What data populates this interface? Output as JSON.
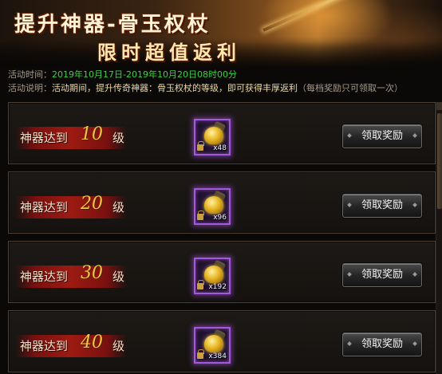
{
  "banner": {
    "title_main": "提升神器-骨玉权杖",
    "title_sub": "限时超值返利"
  },
  "info": {
    "time_label": "活动时间：",
    "time_value": "2019年10月17日-2019年10月20日08时00分",
    "desc_label": "活动说明：",
    "desc_value": "活动期间，提升传奇神器：骨玉权杖的等级，即可获得丰厚返利",
    "desc_note": "（每档奖励只可领取一次）"
  },
  "rows": [
    {
      "label": "神器达到",
      "level": "10",
      "unit": "级",
      "item_count": "x48",
      "button": "领取奖励"
    },
    {
      "label": "神器达到",
      "level": "20",
      "unit": "级",
      "item_count": "x96",
      "button": "领取奖励"
    },
    {
      "label": "神器达到",
      "level": "30",
      "unit": "级",
      "item_count": "x192",
      "button": "领取奖励"
    },
    {
      "label": "神器达到",
      "level": "40",
      "unit": "级",
      "item_count": "x384",
      "button": "领取奖励"
    }
  ],
  "colors": {
    "time_text": "#3fce3f",
    "level_number": "#f5c242",
    "item_border": "#a45ad8",
    "level_bar": "#9c1b12"
  },
  "icons": {
    "item": "golden-relic-icon",
    "lock": "lock-icon"
  }
}
